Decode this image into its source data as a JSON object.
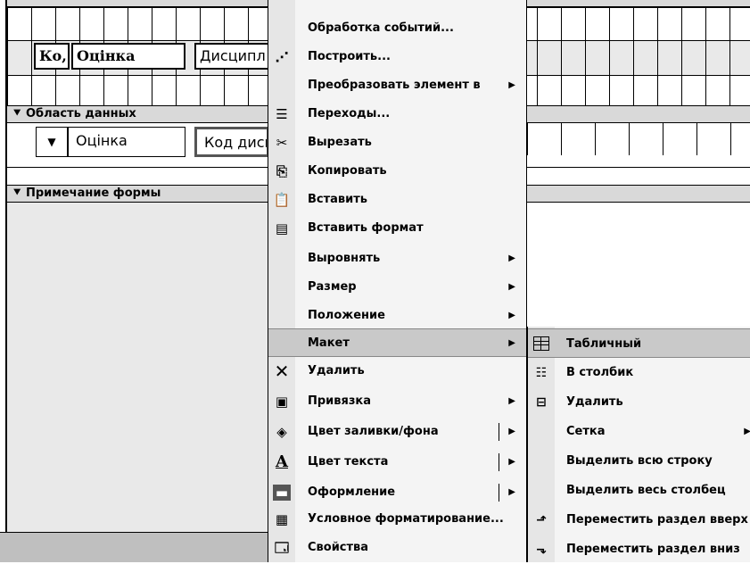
{
  "form": {
    "header_labels": [
      "Ко,",
      "Оцінка",
      "Дисципл"
    ],
    "detail_section": "Область данных",
    "detail_controls": [
      "Оцінка",
      "Код дисц"
    ],
    "footer_section": "Примечание формы"
  },
  "context_menu": {
    "items": [
      {
        "label": "Обработка событий...",
        "icon": "",
        "submenu": false
      },
      {
        "label": "Построить...",
        "icon": "build-wand-icon",
        "submenu": false
      },
      {
        "label": "Преобразовать элемент в",
        "icon": "",
        "submenu": true
      },
      {
        "label": "Переходы...",
        "icon": "tab-order-icon",
        "submenu": false
      },
      {
        "label": "Вырезать",
        "icon": "scissors-icon",
        "submenu": false
      },
      {
        "label": "Копировать",
        "icon": "copy-icon",
        "submenu": false
      },
      {
        "label": "Вставить",
        "icon": "paste-icon",
        "submenu": false
      },
      {
        "label": "Вставить формат",
        "icon": "paste-format-icon",
        "submenu": false
      },
      {
        "label": "Выровнять",
        "icon": "",
        "submenu": true
      },
      {
        "label": "Размер",
        "icon": "",
        "submenu": true
      },
      {
        "label": "Положение",
        "icon": "",
        "submenu": true
      },
      {
        "label": "Макет",
        "icon": "",
        "submenu": true,
        "highlighted": true
      },
      {
        "label": "Удалить",
        "icon": "delete-x-icon",
        "submenu": false
      },
      {
        "label": "Привязка",
        "icon": "anchor-icon",
        "submenu": true
      },
      {
        "label": "Цвет заливки/фона",
        "icon": "fill-color-icon",
        "submenu": true
      },
      {
        "label": "Цвет текста",
        "icon": "font-color-icon",
        "submenu": true
      },
      {
        "label": "Оформление",
        "icon": "special-effect-icon",
        "submenu": true
      },
      {
        "label": "Условное форматирование...",
        "icon": "conditional-format-icon",
        "submenu": false
      },
      {
        "label": "Свойства",
        "icon": "properties-icon",
        "submenu": false
      }
    ]
  },
  "layout_submenu": {
    "items": [
      {
        "label": "Табличный",
        "icon": "tabular-layout-icon",
        "highlighted": true
      },
      {
        "label": "В столбик",
        "icon": "stacked-layout-icon"
      },
      {
        "label": "Удалить",
        "icon": "remove-layout-icon"
      },
      {
        "label": "Сетка",
        "icon": "",
        "submenu": true
      },
      {
        "label": "Выделить всю строку",
        "icon": ""
      },
      {
        "label": "Выделить весь столбец",
        "icon": ""
      },
      {
        "label": "Переместить раздел вверх",
        "icon": "move-up-icon"
      },
      {
        "label": "Переместить раздел вниз",
        "icon": "move-down-icon"
      }
    ]
  }
}
